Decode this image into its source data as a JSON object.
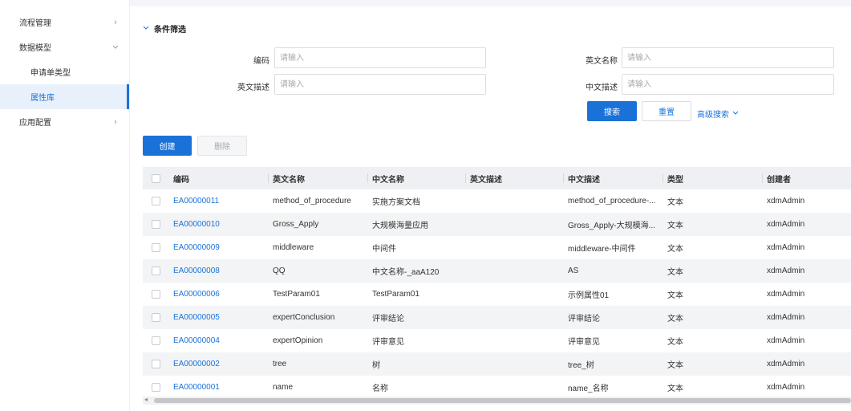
{
  "sidebar": {
    "items": [
      {
        "label": "流程管理"
      },
      {
        "label": "数据模型"
      },
      {
        "label": "申请单类型"
      },
      {
        "label": "属性库"
      },
      {
        "label": "应用配置"
      }
    ]
  },
  "filter": {
    "title": "条件筛选",
    "fields": {
      "code": {
        "label": "编码",
        "placeholder": "请输入"
      },
      "en_name": {
        "label": "英文名称",
        "placeholder": "请输入"
      },
      "en_desc": {
        "label": "英文描述",
        "placeholder": "请输入"
      },
      "cn_desc": {
        "label": "中文描述",
        "placeholder": "请输入"
      }
    },
    "search_label": "搜索",
    "reset_label": "重置",
    "advanced_label": "高级搜索"
  },
  "toolbar": {
    "create_label": "创建",
    "delete_label": "删除"
  },
  "table": {
    "columns": [
      "编码",
      "英文名称",
      "中文名称",
      "英文描述",
      "中文描述",
      "类型",
      "创建者"
    ],
    "rows": [
      {
        "code": "EA00000011",
        "en_name": "method_of_procedure",
        "cn_name": "实施方案文档",
        "en_desc": "",
        "cn_desc": "method_of_procedure-...",
        "type": "文本",
        "creator": "xdmAdmin"
      },
      {
        "code": "EA00000010",
        "en_name": "Gross_Apply",
        "cn_name": "大规模海量应用",
        "en_desc": "",
        "cn_desc": "Gross_Apply-大规模海...",
        "type": "文本",
        "creator": "xdmAdmin"
      },
      {
        "code": "EA00000009",
        "en_name": "middleware",
        "cn_name": "中间件",
        "en_desc": "",
        "cn_desc": "middleware-中间件",
        "type": "文本",
        "creator": "xdmAdmin"
      },
      {
        "code": "EA00000008",
        "en_name": "QQ",
        "cn_name": "中文名称-_aaA120",
        "en_desc": "",
        "cn_desc": "AS",
        "type": "文本",
        "creator": "xdmAdmin"
      },
      {
        "code": "EA00000006",
        "en_name": "TestParam01",
        "cn_name": "TestParam01",
        "en_desc": "",
        "cn_desc": "示例属性01",
        "type": "文本",
        "creator": "xdmAdmin"
      },
      {
        "code": "EA00000005",
        "en_name": "expertConclusion",
        "cn_name": "评审结论",
        "en_desc": "",
        "cn_desc": "评审结论",
        "type": "文本",
        "creator": "xdmAdmin"
      },
      {
        "code": "EA00000004",
        "en_name": "expertOpinion",
        "cn_name": "评审意见",
        "en_desc": "",
        "cn_desc": "评审意见",
        "type": "文本",
        "creator": "xdmAdmin"
      },
      {
        "code": "EA00000002",
        "en_name": "tree",
        "cn_name": "树",
        "en_desc": "",
        "cn_desc": "tree_树",
        "type": "文本",
        "creator": "xdmAdmin"
      },
      {
        "code": "EA00000001",
        "en_name": "name",
        "cn_name": "名称",
        "en_desc": "",
        "cn_desc": "name_名称",
        "type": "文本",
        "creator": "xdmAdmin"
      }
    ]
  },
  "colors": {
    "accent": "#1a72d9",
    "header_bg": "#eef0f3",
    "row_alt": "#f3f4f6"
  }
}
